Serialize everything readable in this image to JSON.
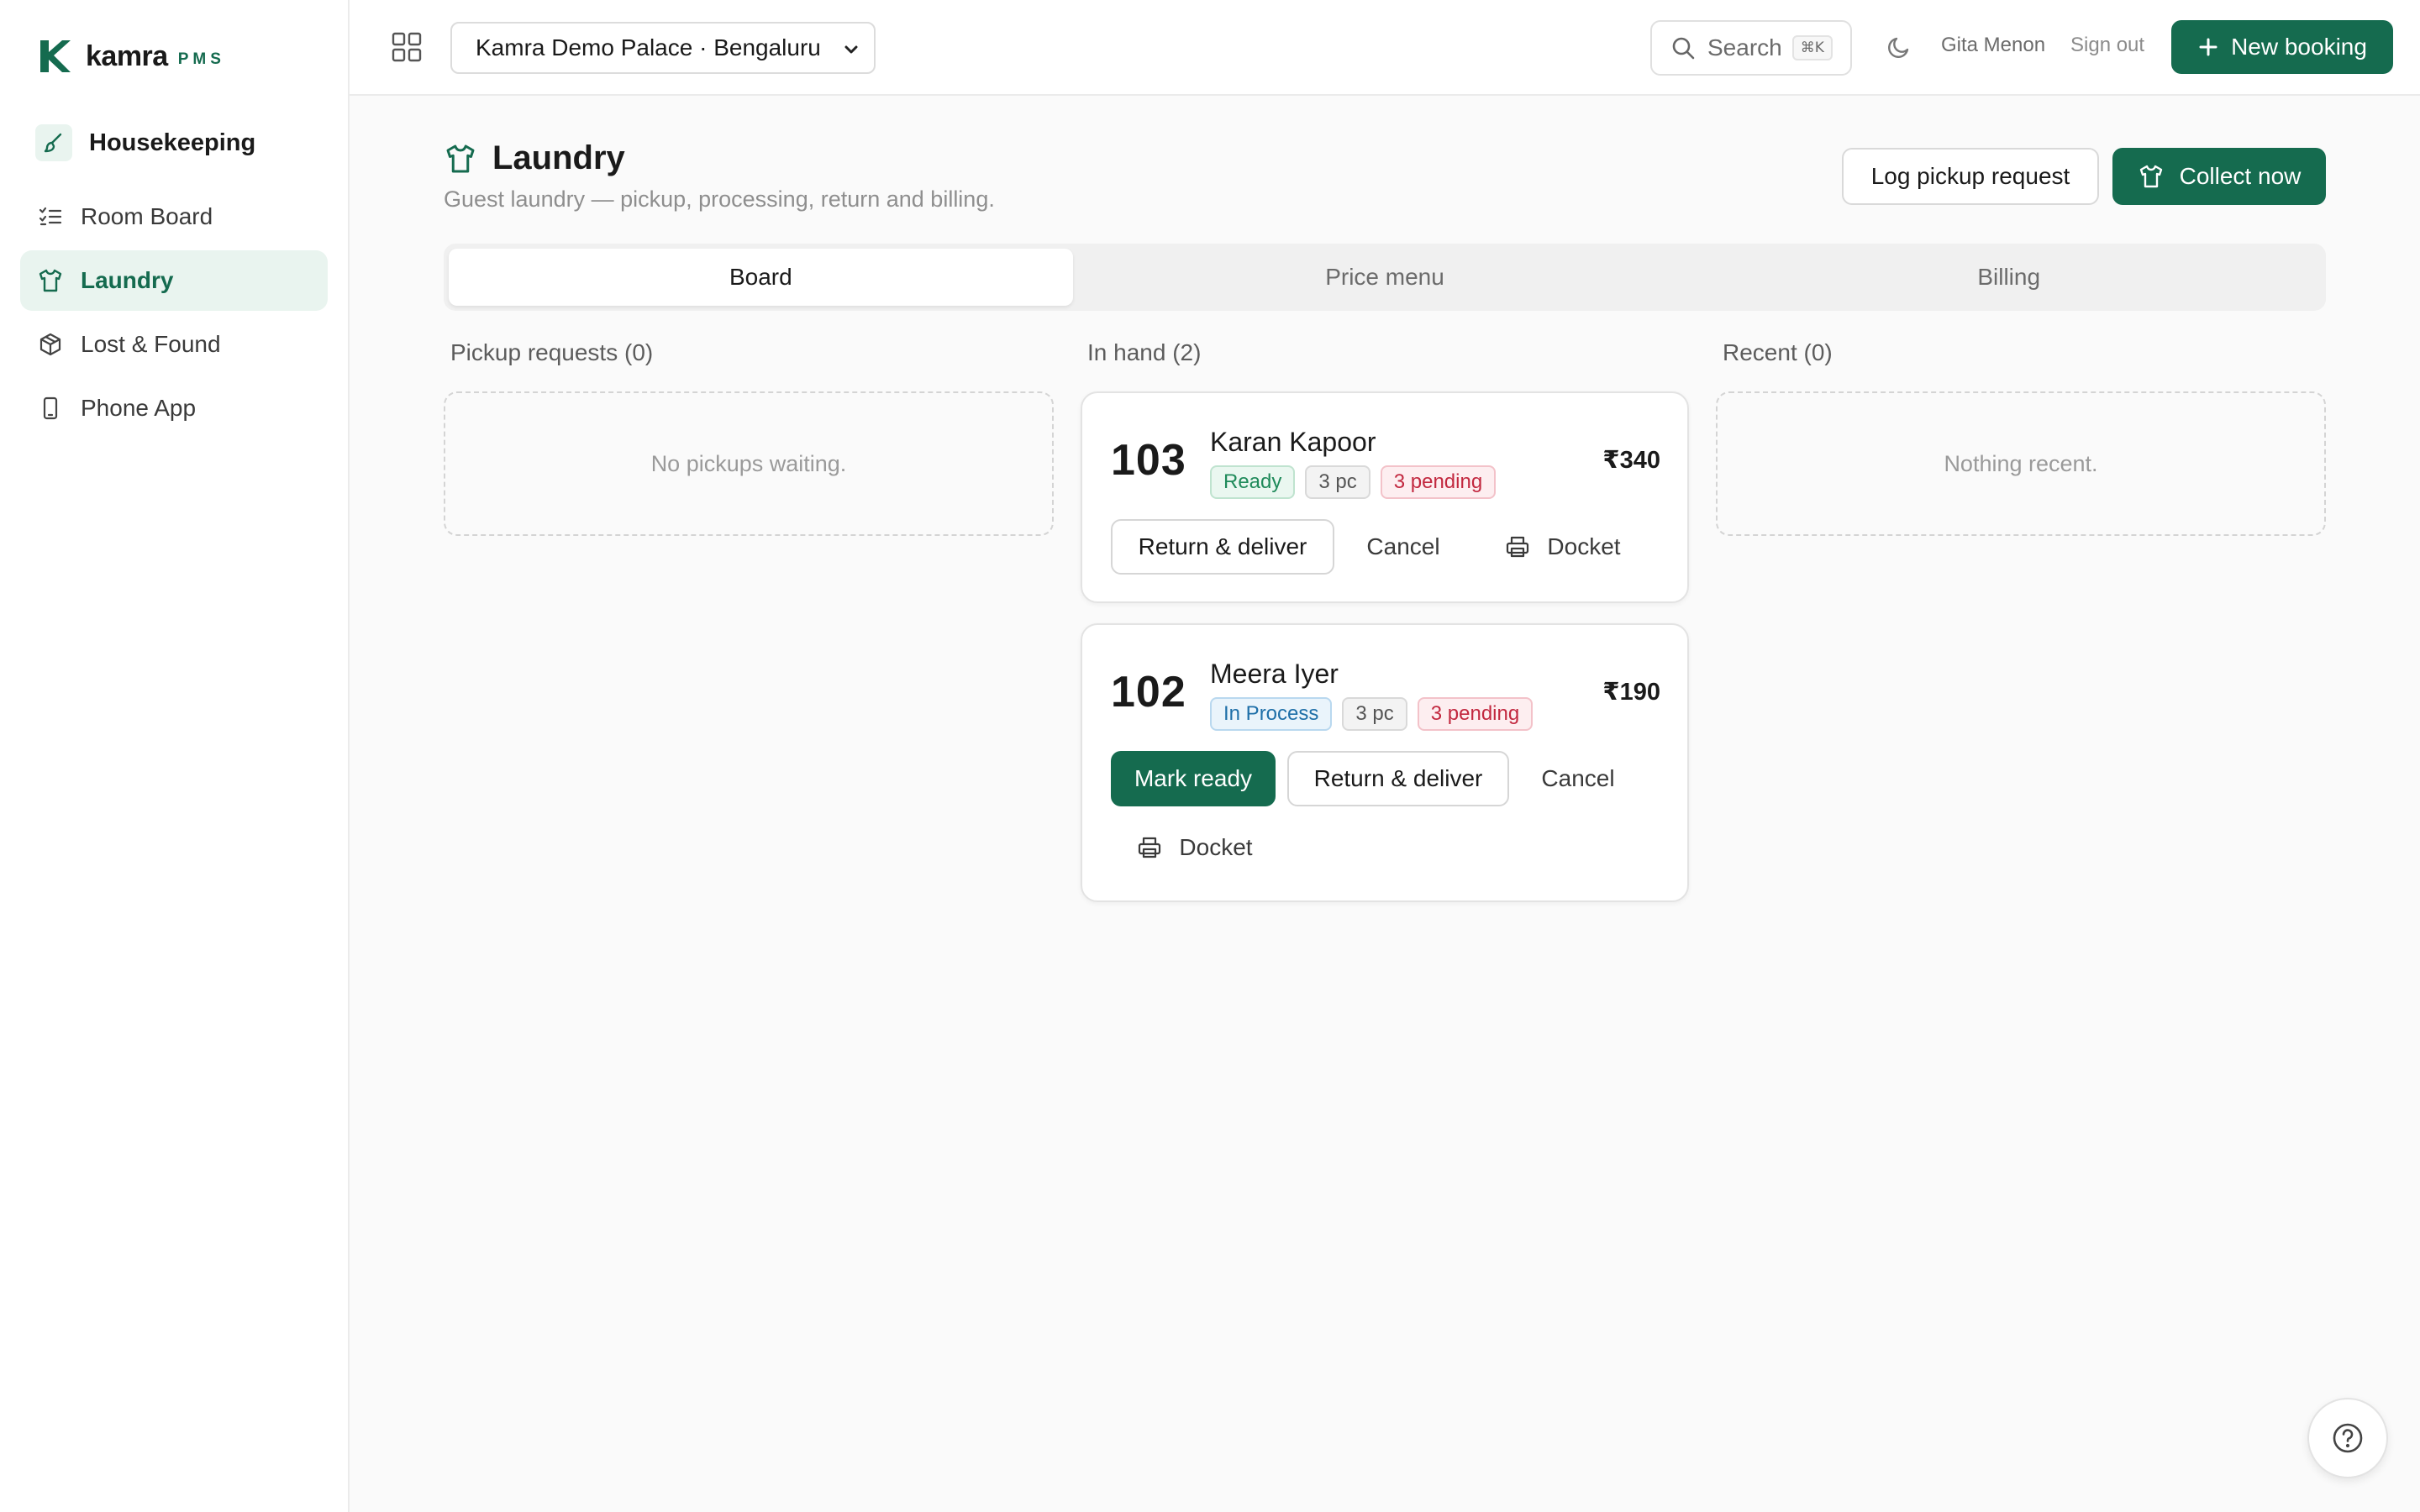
{
  "brand": {
    "name": "kamra",
    "sub": "PMS",
    "color": "#156b4f"
  },
  "sidebar": {
    "section": "Housekeeping",
    "items": [
      {
        "label": "Room Board",
        "icon": "checklist-icon",
        "active": false
      },
      {
        "label": "Laundry",
        "icon": "shirt-icon",
        "active": true
      },
      {
        "label": "Lost & Found",
        "icon": "package-icon",
        "active": false
      },
      {
        "label": "Phone App",
        "icon": "phone-icon",
        "active": false
      }
    ]
  },
  "topbar": {
    "property": "Kamra Demo Palace · Bengaluru",
    "search_label": "Search",
    "search_shortcut": "⌘K",
    "user_name": "Gita Menon",
    "signout_label": "Sign out",
    "new_booking_label": "New booking"
  },
  "page": {
    "title": "Laundry",
    "subtitle": "Guest laundry — pickup, processing, return and billing.",
    "log_pickup_label": "Log pickup request",
    "collect_label": "Collect now"
  },
  "tabs": [
    {
      "label": "Board",
      "active": true
    },
    {
      "label": "Price menu",
      "active": false
    },
    {
      "label": "Billing",
      "active": false
    }
  ],
  "columns": {
    "pickup": {
      "title": "Pickup requests (0)",
      "empty": "No pickups waiting."
    },
    "in_hand": {
      "title": "In hand (2)"
    },
    "recent": {
      "title": "Recent (0)",
      "empty": "Nothing recent."
    }
  },
  "orders": [
    {
      "room": "103",
      "guest": "Karan Kapoor",
      "amount": "₹340",
      "status": "Ready",
      "pieces": "3 pc",
      "pending": "3 pending",
      "actions": {
        "return": "Return & deliver",
        "cancel": "Cancel",
        "docket": "Docket"
      }
    },
    {
      "room": "102",
      "guest": "Meera Iyer",
      "amount": "₹190",
      "status": "In Process",
      "pieces": "3 pc",
      "pending": "3 pending",
      "actions": {
        "mark_ready": "Mark ready",
        "return": "Return & deliver",
        "cancel": "Cancel",
        "docket": "Docket"
      }
    }
  ]
}
